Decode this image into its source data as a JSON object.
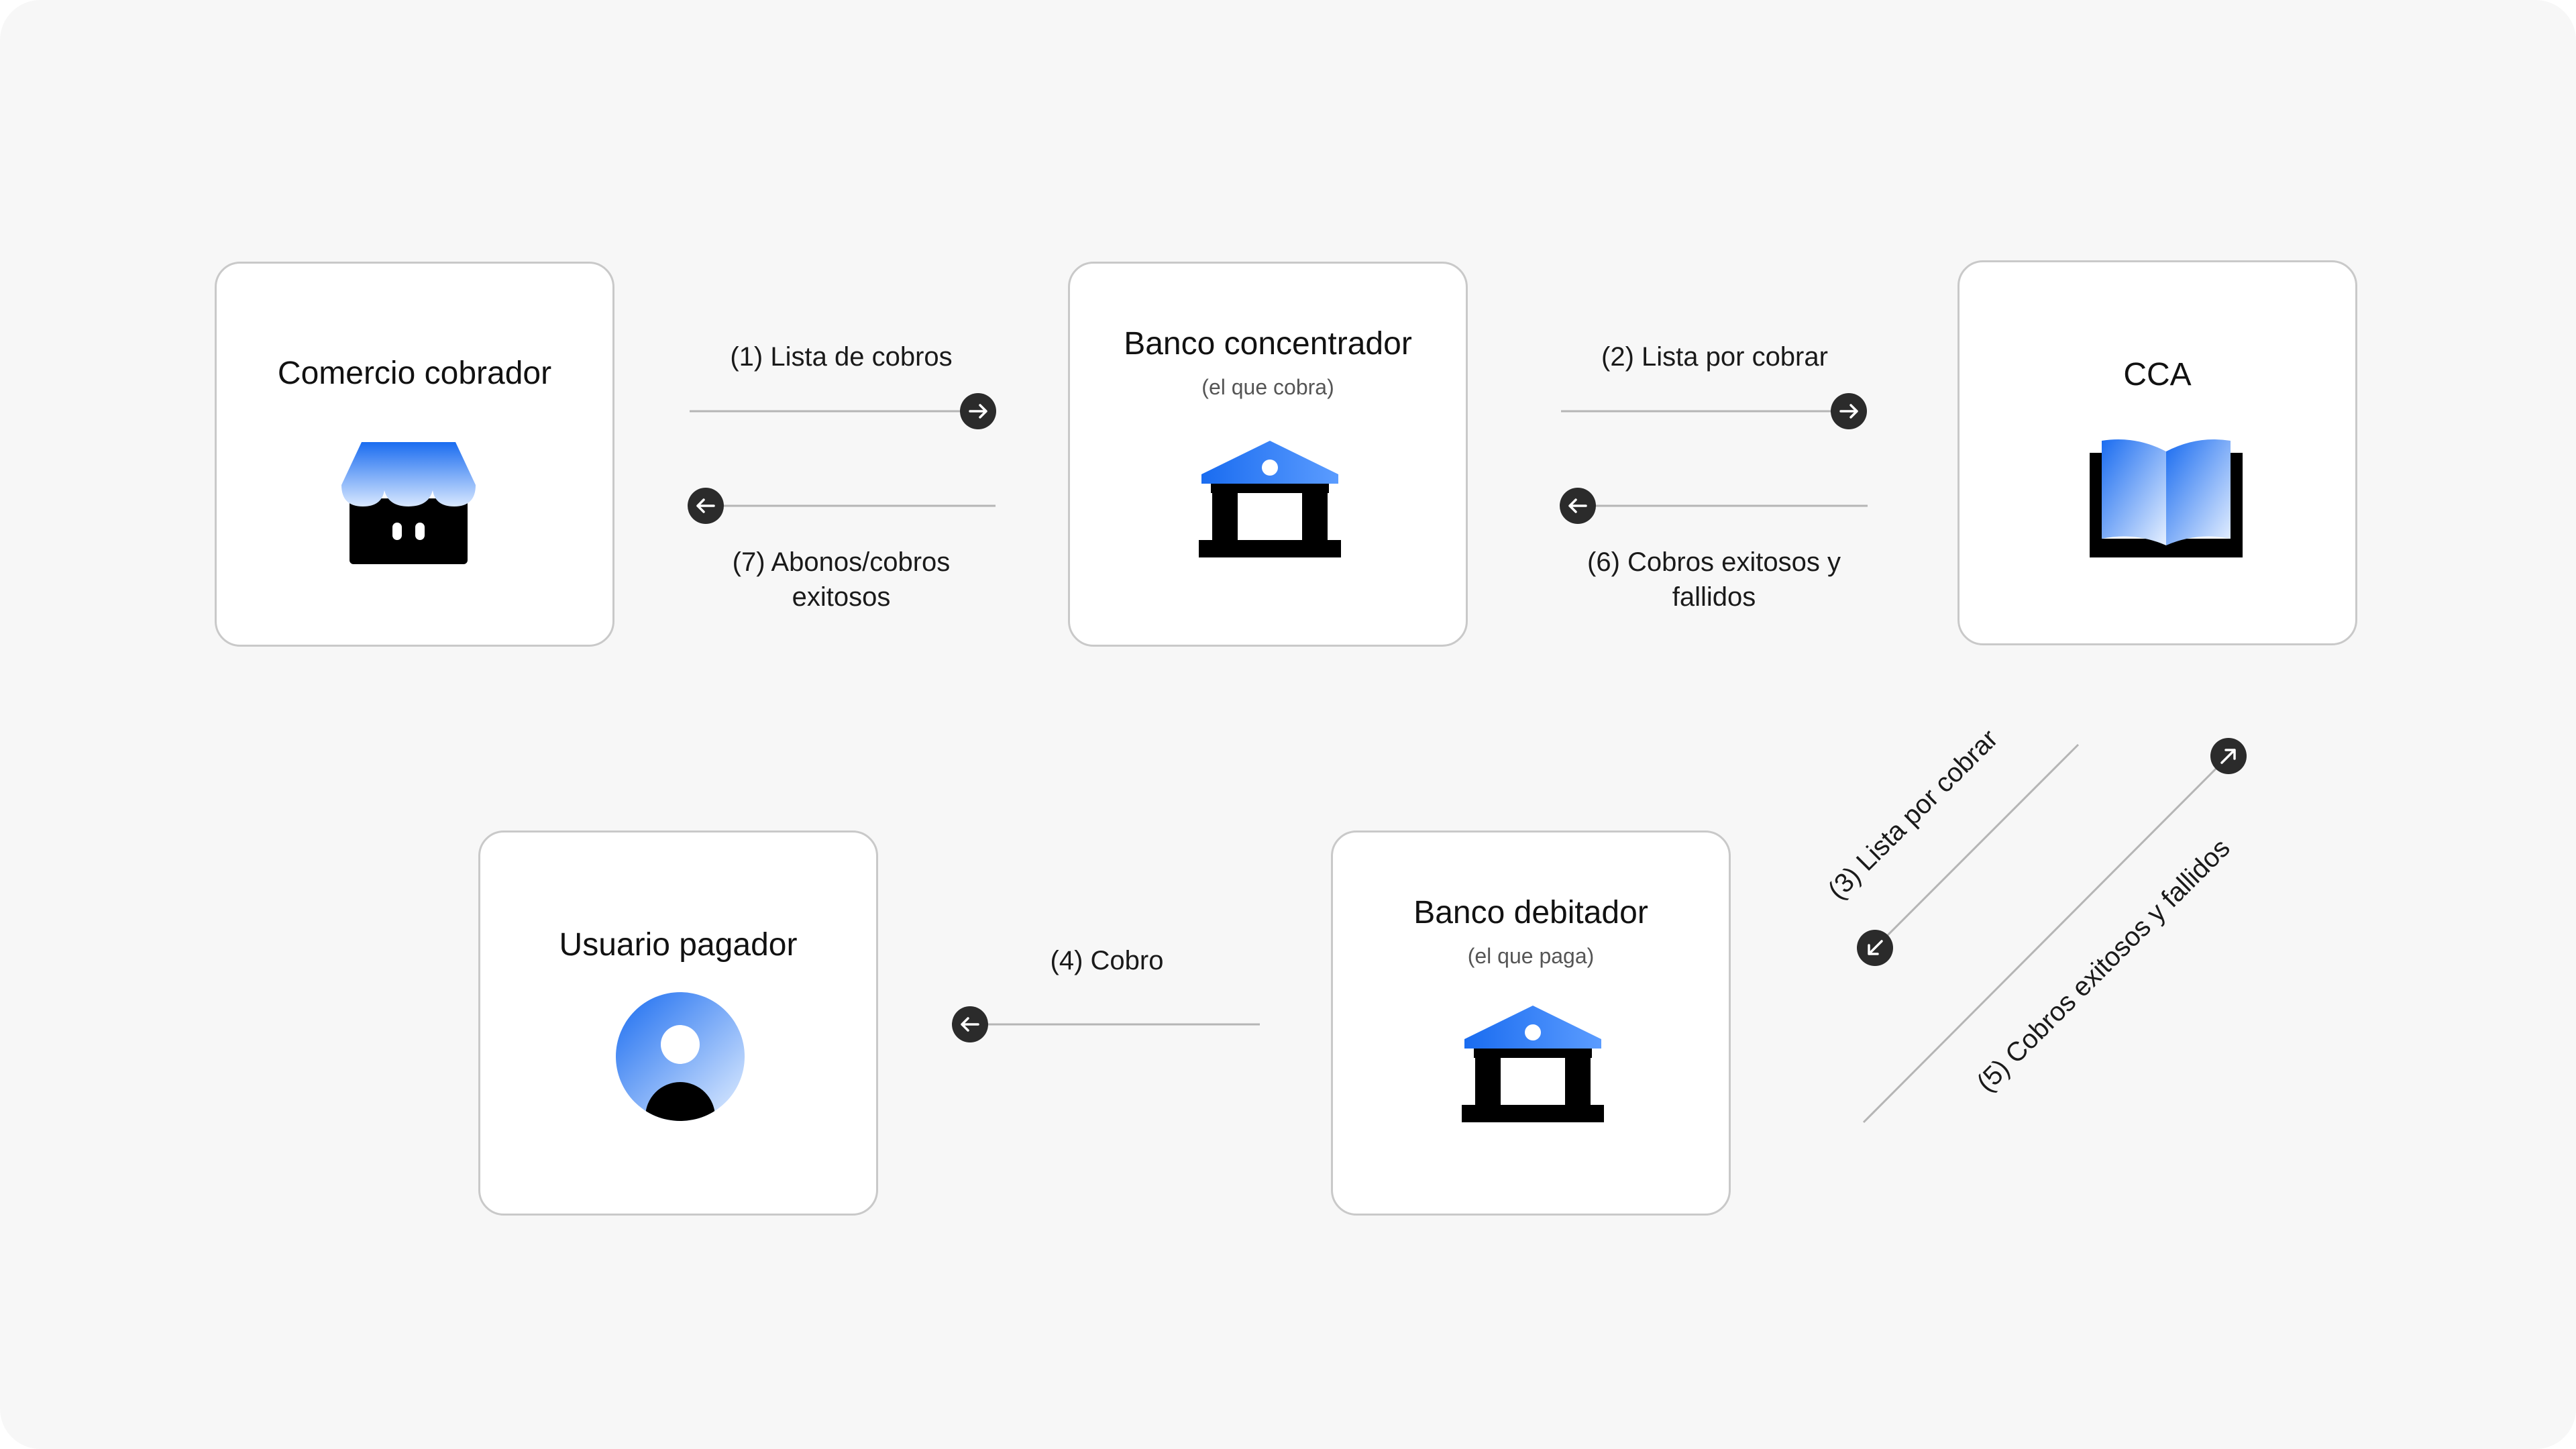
{
  "nodes": {
    "comercio": {
      "title": "Comercio cobrador",
      "icon": "storefront-icon"
    },
    "banco_concentrador": {
      "title": "Banco concentrador",
      "subtitle": "(el que cobra)",
      "icon": "bank-icon"
    },
    "cca": {
      "title": "CCA",
      "icon": "open-book-icon"
    },
    "usuario": {
      "title": "Usuario pagador",
      "icon": "user-avatar-icon"
    },
    "banco_debitador": {
      "title": "Banco debitador",
      "subtitle": "(el que paga)",
      "icon": "bank-icon"
    }
  },
  "edges": {
    "e1": "(1) Lista de cobros",
    "e2": "(2) Lista por cobrar",
    "e3": "(3) Lista por cobrar",
    "e4": "(4) Cobro",
    "e5": "(5) Cobros exitosos y fallidos",
    "e6": "(6) Cobros exitosos y fallidos",
    "e7": "(7) Abonos/cobros exitosos"
  },
  "colors": {
    "background": "#f7f7f7",
    "card_border": "#c9c9c9",
    "connector_line": "#b5b5b5",
    "arrow_badge": "#2b2b2b",
    "icon_dark": "#000000",
    "icon_blue": "#1a6cf0",
    "icon_light_blue": "#cfe2ff"
  }
}
